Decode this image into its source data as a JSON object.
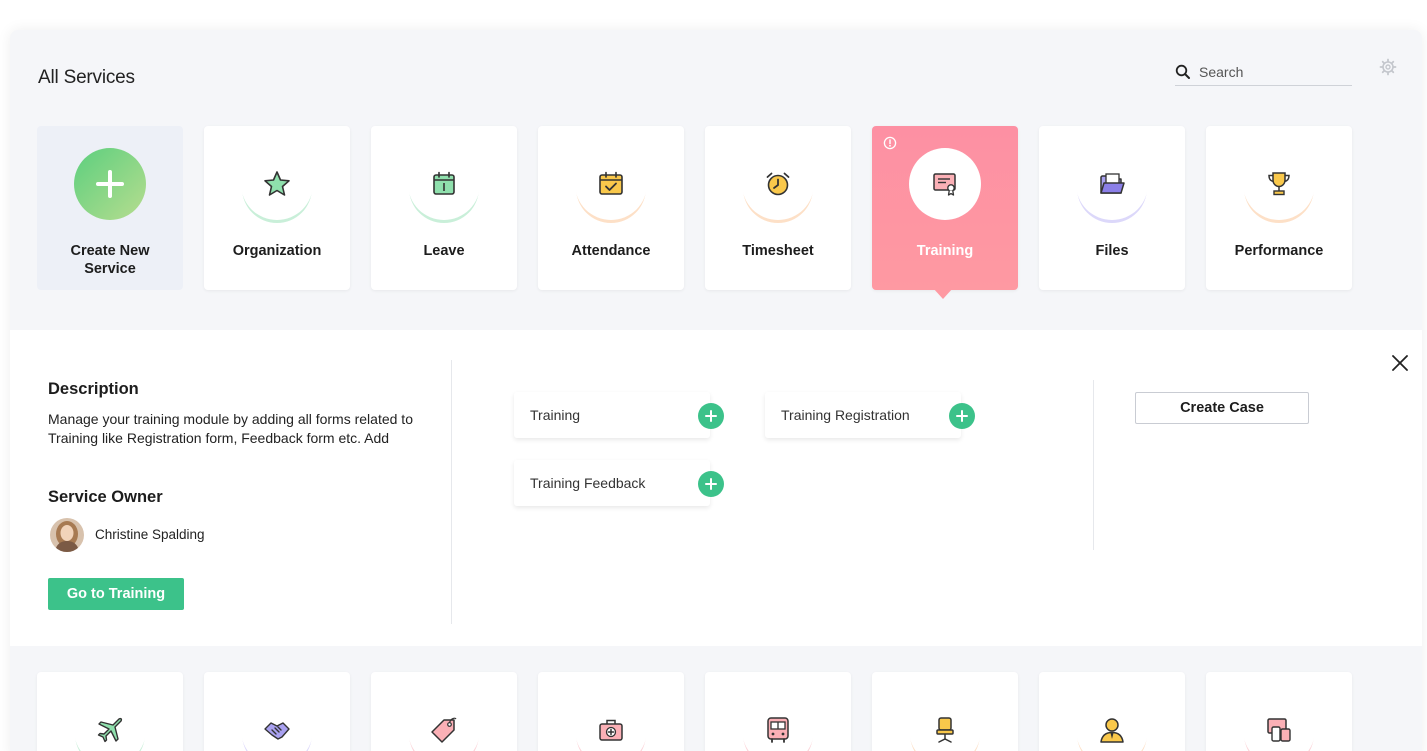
{
  "header": {
    "title": "All Services",
    "search_placeholder": "Search",
    "search_value": ""
  },
  "services": [
    {
      "label": "Create New Service",
      "icon": "plus-icon",
      "ring_color": "#5ccf7e"
    },
    {
      "label": "Organization",
      "icon": "star-icon",
      "ring_color": "#58c785"
    },
    {
      "label": "Leave",
      "icon": "calendar-icon",
      "ring_color": "#58c785"
    },
    {
      "label": "Attendance",
      "icon": "calendar-check-icon",
      "ring_color": "#f6a35b"
    },
    {
      "label": "Timesheet",
      "icon": "alarm-clock-icon",
      "ring_color": "#f6a35b"
    },
    {
      "label": "Training",
      "icon": "certificate-icon",
      "ring_color": "#ffffff",
      "active": true
    },
    {
      "label": "Files",
      "icon": "folder-icon",
      "ring_color": "#8b7fe8"
    },
    {
      "label": "Performance",
      "icon": "trophy-icon",
      "ring_color": "#f6a35b"
    }
  ],
  "detail": {
    "description_heading": "Description",
    "description_text": "Manage your training module by adding all forms related to Training like Registration form, Feedback form etc. Add",
    "owner_heading": "Service Owner",
    "owner_name": "Christine Spalding",
    "go_button": "Go to Training",
    "forms": [
      {
        "label": "Training"
      },
      {
        "label": "Training Registration"
      },
      {
        "label": "Training Feedback"
      }
    ],
    "create_case_button": "Create Case"
  },
  "bottom_services": [
    {
      "icon": "airplane-icon"
    },
    {
      "icon": "handshake-icon"
    },
    {
      "icon": "tag-icon"
    },
    {
      "icon": "medical-kit-icon"
    },
    {
      "icon": "bus-icon"
    },
    {
      "icon": "office-chair-icon"
    },
    {
      "icon": "person-icon"
    },
    {
      "icon": "devices-icon"
    }
  ],
  "colors": {
    "accent_green": "#3cc28a",
    "active_pink": "#fe99a2",
    "panel_bg": "#f5f6f9"
  }
}
